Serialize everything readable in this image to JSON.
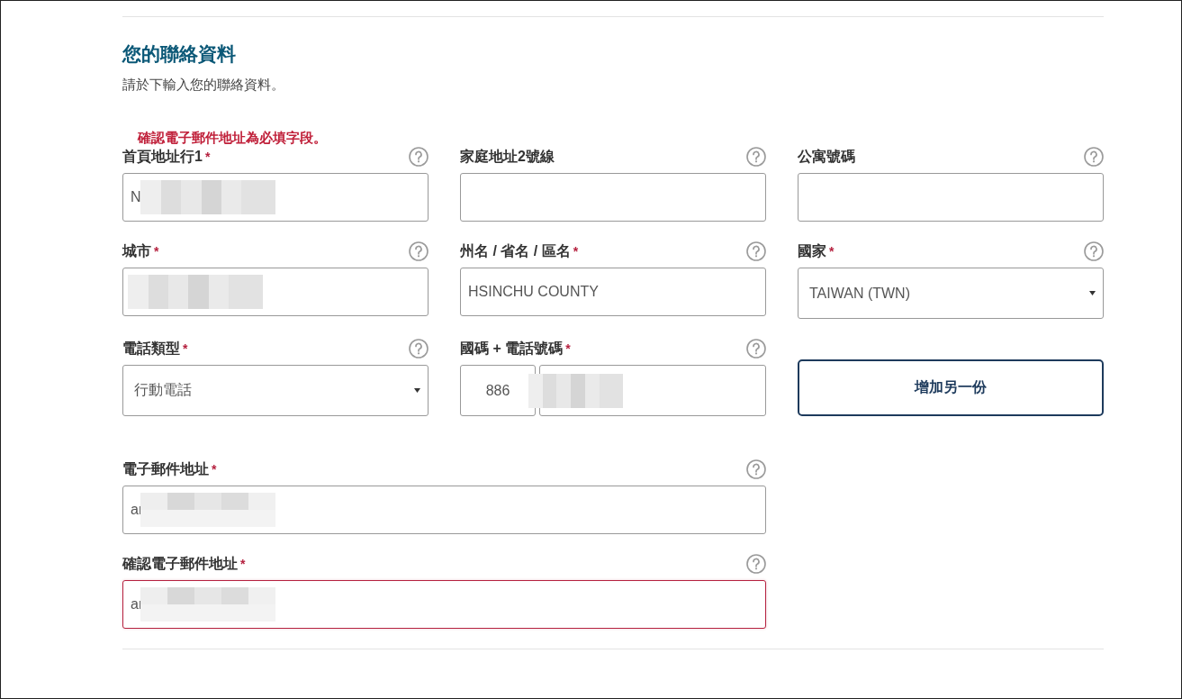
{
  "heading": "您的聯絡資料",
  "subtitle": "請於下輸入您的聯絡資料。",
  "error": "確認電子郵件地址為必填字段。",
  "fields": [
    {
      "kind": "text",
      "label": "首頁地址行1",
      "required_mark": "*",
      "value": "N",
      "redacted": true
    },
    {
      "kind": "text",
      "label": "家庭地址2號線"
    },
    {
      "kind": "text",
      "label": "公寓號碼"
    },
    {
      "kind": "text",
      "label": "城市",
      "required_mark": "*",
      "redacted": true
    },
    {
      "kind": "text",
      "label": "州名 / 省名 / 區名",
      "required_mark": "*",
      "value": "HSINCHU COUNTY"
    },
    {
      "kind": "select",
      "label": "國家",
      "required_mark": "*",
      "value": "TAIWAN (TWN)"
    },
    {
      "kind": "select",
      "label": "電話類型",
      "required_mark": "*",
      "value": "行動電話"
    },
    {
      "kind": "phone",
      "label": "國碼 + 電話號碼",
      "required_mark": "*",
      "code": "886",
      "redacted": true
    },
    {
      "kind": "button",
      "label": "增加另一份"
    },
    {
      "kind": "wide",
      "label": "電子郵件地址",
      "required_mark": "*",
      "value": "ar",
      "redacted": true
    },
    {
      "kind": "wide",
      "label": "確認電子郵件地址",
      "required_mark": "*",
      "value": "ar",
      "redacted": true,
      "invalid": true
    }
  ]
}
